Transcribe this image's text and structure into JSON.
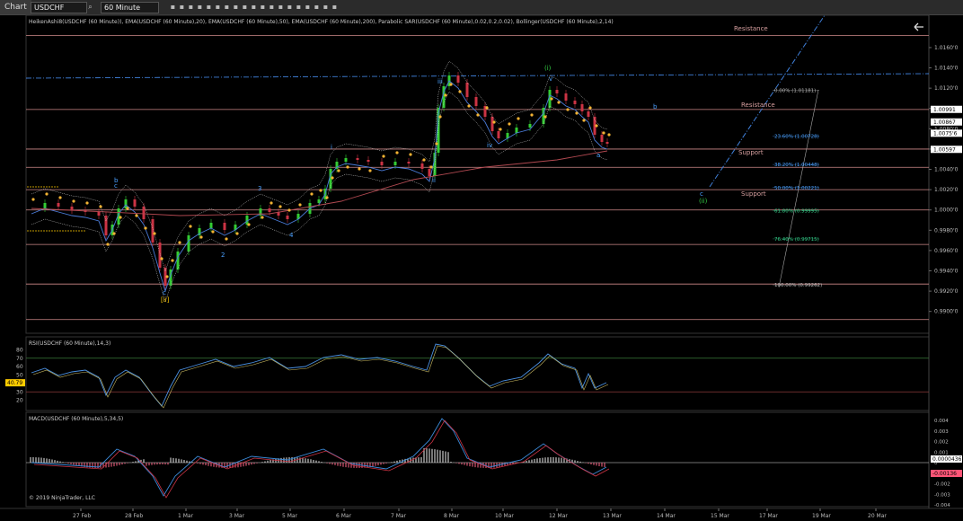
{
  "toolbar": {
    "chart_label": "Chart",
    "symbol": "USDCHF",
    "timeframe": "60 Minute",
    "icons": [
      "search-icon",
      "zoom-in-icon",
      "zoom-out-icon",
      "bar-chart-icon",
      "properties-icon",
      "indicators-icon",
      "strategies-icon",
      "drawing-icon",
      "pointer-icon",
      "crosshair-icon",
      "global-crosshair-icon",
      "text-icon",
      "line-icon",
      "ray-icon",
      "horizontal-line-icon",
      "fibonacci-icon",
      "rectangle-icon",
      "ellipse-icon",
      "arrow-icon",
      "snapshot-icon"
    ]
  },
  "price_panel": {
    "header": "HeikenAshi8(USDCHF (60 Minute)), EMA(USDCHF (60 Minute),20), EMA(USDCHF (60 Minute),50), EMA(USDCHF (60 Minute),200), Parabolic SAR(USDCHF (60 Minute),0.02,0.2,0.02), Bollinger(USDCHF (60 Minute),2,14)",
    "y_ticks": [
      "1.0160'0",
      "1.0140'0",
      "1.0120'0",
      "1.0100'0",
      "1.0080'0",
      "1.0060'0",
      "1.0040'0",
      "1.0020'0",
      "1.0000'0",
      "0.9980'0",
      "0.9960'0",
      "0.9940'0",
      "0.9920'0",
      "0.9900'0"
    ],
    "price_badges": [
      {
        "text": "1.00991",
        "bg": "#ffffff",
        "fg": "#000000"
      },
      {
        "text": "1.00867",
        "bg": "#ffffff",
        "fg": "#000000"
      },
      {
        "text": "1.0075'6",
        "bg": "#ffffff",
        "fg": "#000000"
      },
      {
        "text": "1.00597",
        "bg": "#ffffff",
        "fg": "#000000"
      }
    ],
    "sr_labels": [
      {
        "text": "Resistance"
      },
      {
        "text": "Resistance"
      },
      {
        "text": "Support"
      },
      {
        "text": "Support"
      }
    ],
    "fib_labels": [
      {
        "text": "0.00% (1.01181)",
        "color": "#bbbbbb"
      },
      {
        "text": "23.60% (1.00728)",
        "color": "#4aa0ff"
      },
      {
        "text": "38.20% (1.00448)",
        "color": "#4aa0ff"
      },
      {
        "text": "50.00% (1.00221)",
        "color": "#4aa0ff"
      },
      {
        "text": "61.80% (0.99995)",
        "color": "#33cc88"
      },
      {
        "text": "76.40% (0.99715)",
        "color": "#33cc88"
      },
      {
        "text": "100.00% (0.99262)",
        "color": "#bbbbbb"
      }
    ],
    "wave_labels": [
      {
        "text": "b",
        "color": "#4aa0ff"
      },
      {
        "text": "c",
        "color": "#4aa0ff"
      },
      {
        "text": "c",
        "color": "#4aa0ff"
      },
      {
        "text": "[ii]",
        "color": "#ffcc00"
      },
      {
        "text": "2",
        "color": "#4aa0ff"
      },
      {
        "text": "3",
        "color": "#4aa0ff"
      },
      {
        "text": "4",
        "color": "#4aa0ff"
      },
      {
        "text": "i",
        "color": "#4aa0ff"
      },
      {
        "text": "ii",
        "color": "#4aa0ff"
      },
      {
        "text": "iii",
        "color": "#4aa0ff"
      },
      {
        "text": "iv",
        "color": "#4aa0ff"
      },
      {
        "text": "v",
        "color": "#4aa0ff"
      },
      {
        "text": "(i)",
        "color": "#33cc44"
      },
      {
        "text": "a",
        "color": "#4aa0ff"
      },
      {
        "text": "b",
        "color": "#4aa0ff"
      },
      {
        "text": "c",
        "color": "#4aa0ff"
      },
      {
        "text": "(ii)",
        "color": "#33cc44"
      }
    ]
  },
  "rsi_panel": {
    "header": "RSI(USDCHF (60 Minute),14,3)",
    "y_ticks": [
      "80",
      "70",
      "60",
      "50",
      "40",
      "30",
      "20"
    ],
    "value_badge": "40.79"
  },
  "macd_panel": {
    "header": "MACD(USDCHF (60 Minute),5,34,5)",
    "y_ticks": [
      "0.004",
      "0.003",
      "0.002",
      "0.001",
      "0",
      "-0.001",
      "-0.002",
      "-0.003",
      "-0.004"
    ],
    "value_badges": [
      {
        "text": "0.0000436",
        "bg": "#ffffff",
        "fg": "#000000"
      },
      {
        "text": "-0.00136",
        "bg": "#ff5577",
        "fg": "#000000"
      }
    ],
    "copyright": "© 2019 NinjaTrader, LLC"
  },
  "x_axis": {
    "labels": [
      "27 Feb",
      "28 Feb",
      "1 Mar",
      "3 Mar",
      "5 Mar",
      "6 Mar",
      "7 Mar",
      "8 Mar",
      "10 Mar",
      "12 Mar",
      "13 Mar",
      "14 Mar",
      "15 Mar",
      "17 Mar",
      "19 Mar",
      "20 Mar"
    ]
  },
  "colors": {
    "background": "#000000",
    "up_candle": "#33cc33",
    "down_candle": "#cc3344",
    "sar": "#f2b233",
    "ema_fast": "#4a7bd8",
    "ema_slow": "#b04850",
    "sr_line": "#d08a8a",
    "blue_dash": "#3f7fd8"
  },
  "chart_data": {
    "type": "candlestick",
    "instrument": "USDCHF",
    "timeframe": "60 Minute",
    "x": [
      "27 Feb",
      "28 Feb",
      "1 Mar",
      "3 Mar",
      "5 Mar",
      "6 Mar",
      "7 Mar",
      "8 Mar",
      "10 Mar",
      "12 Mar",
      "13 Mar"
    ],
    "close_approx": [
      1.0,
      0.9975,
      0.9935,
      0.9985,
      1.001,
      1.005,
      1.0045,
      1.011,
      1.0085,
      1.011,
      1.0076
    ],
    "horizontal_levels": [
      1.0172,
      1.0099,
      1.006,
      1.0042,
      1.002,
      1.0,
      0.9966,
      0.9927,
      0.9892
    ],
    "fibonacci": [
      {
        "level": "0.00%",
        "price": 1.01181
      },
      {
        "level": "23.60%",
        "price": 1.00728
      },
      {
        "level": "38.20%",
        "price": 1.00448
      },
      {
        "level": "50.00%",
        "price": 1.00221
      },
      {
        "level": "61.80%",
        "price": 0.99995
      },
      {
        "level": "76.40%",
        "price": 0.99715
      },
      {
        "level": "100.00%",
        "price": 0.99262
      }
    ],
    "current_price": 1.00756,
    "ylim": [
      0.989,
      1.0175
    ],
    "rsi_last": 40.79,
    "macd_last": [
      4.36e-05,
      -0.00136
    ]
  }
}
